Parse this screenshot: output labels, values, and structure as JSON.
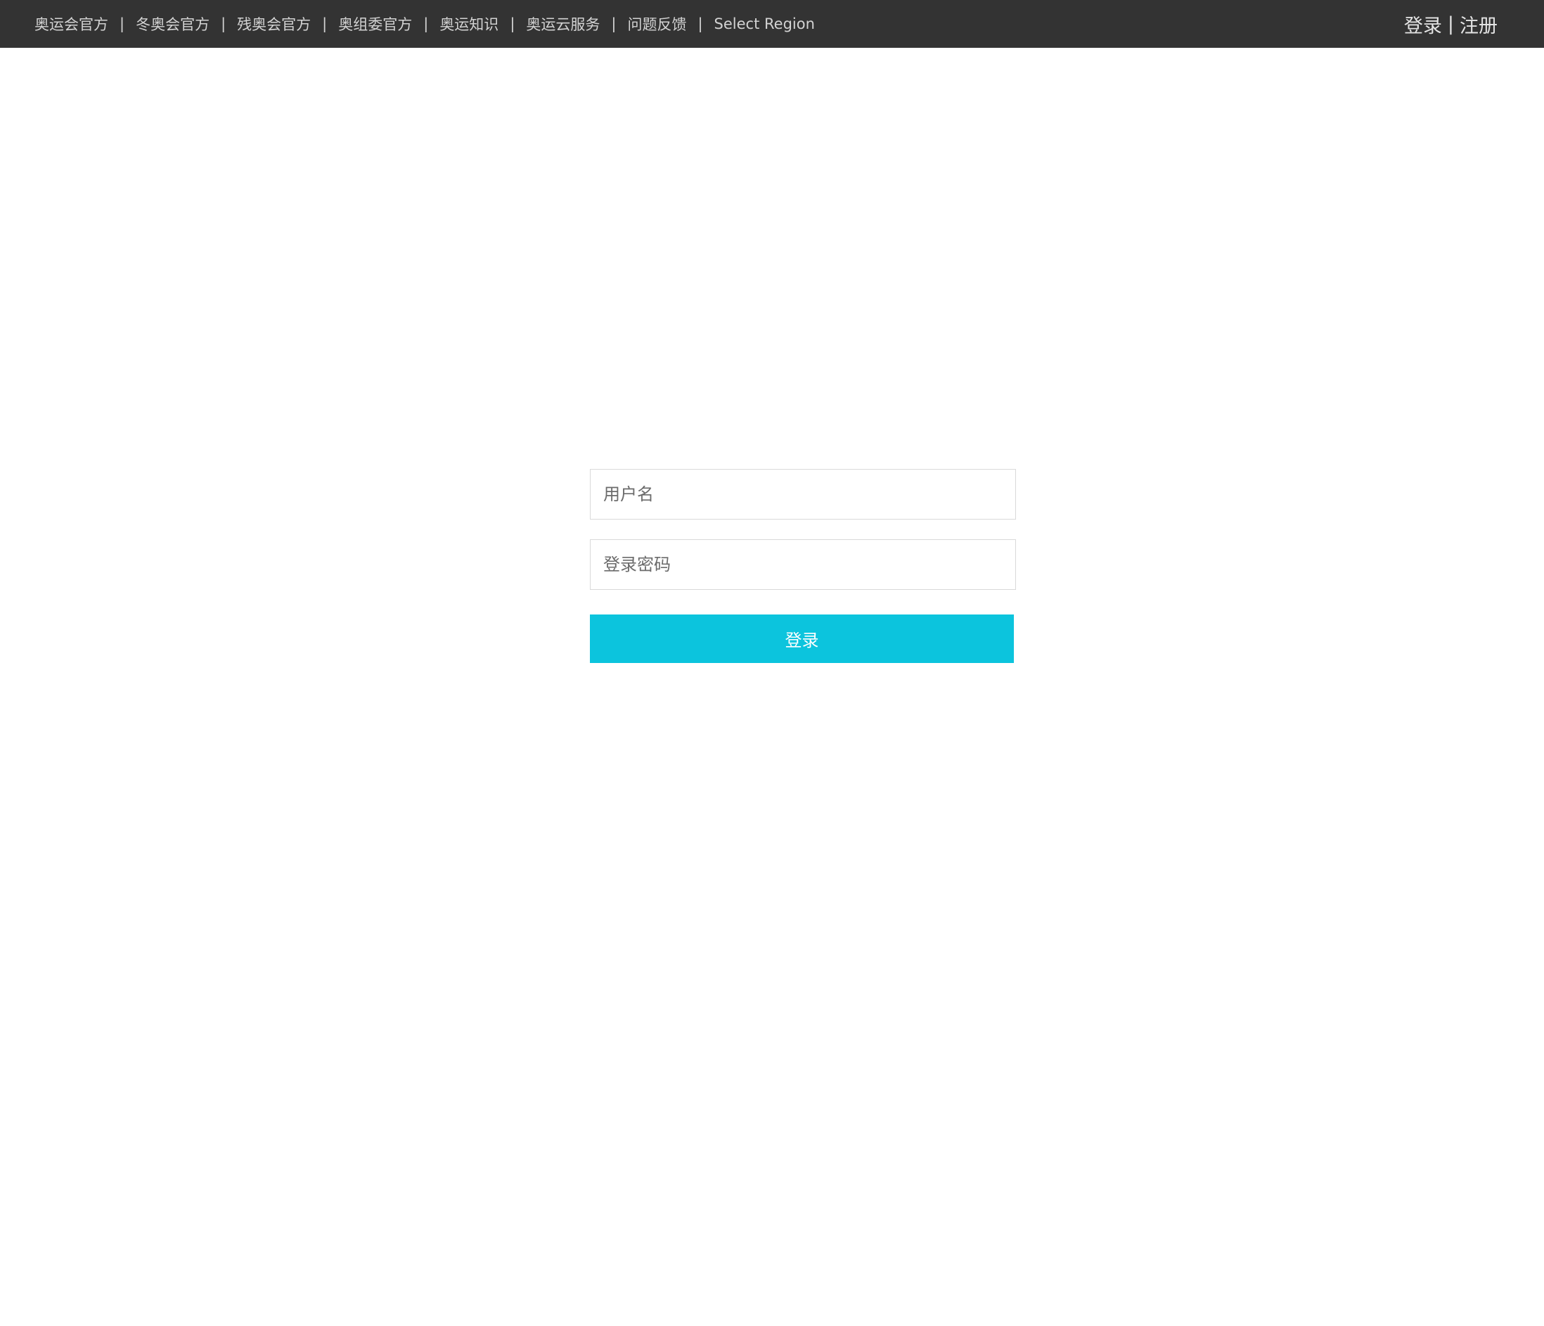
{
  "header": {
    "nav_items": [
      {
        "label": "奥运会官方"
      },
      {
        "label": "冬奥会官方"
      },
      {
        "label": "残奥会官方"
      },
      {
        "label": "奥组委官方"
      },
      {
        "label": "奥运知识"
      },
      {
        "label": "奥运云服务"
      },
      {
        "label": "问题反馈"
      },
      {
        "label": "Select Region"
      }
    ],
    "separator": "|",
    "auth": {
      "login": "登录",
      "separator": "|",
      "register": "注册"
    }
  },
  "login_form": {
    "username_placeholder": "用户名",
    "password_placeholder": "登录密码",
    "submit_label": "登录"
  },
  "colors": {
    "topbar_bg": "#333333",
    "accent": "#0cc4dd"
  }
}
